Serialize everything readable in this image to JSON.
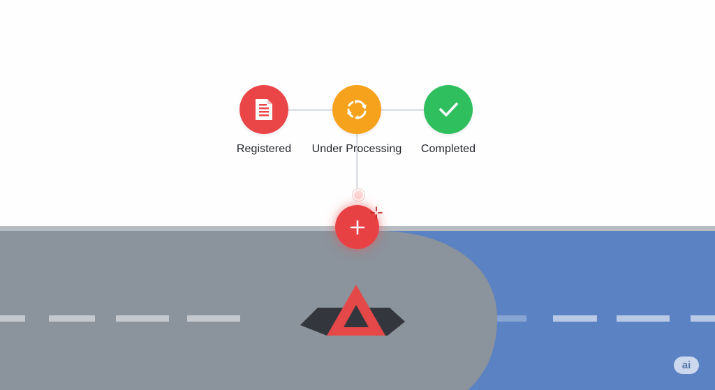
{
  "stepper": {
    "steps": [
      {
        "label": "Registered",
        "icon": "document-icon",
        "color": "#ea4647"
      },
      {
        "label": "Under Processing",
        "icon": "refresh-icon",
        "color": "#f7a21c"
      },
      {
        "label": "Completed",
        "icon": "checkmark-icon",
        "color": "#2fbf5f"
      }
    ]
  },
  "actions": {
    "add_icon": "plus-icon",
    "add_color": "#e84143"
  },
  "map": {
    "road_color": "#8b939c",
    "water_color": "#5b82c2",
    "marker_icon": "warning-triangle-icon",
    "marker_color": "#e54848"
  },
  "badge": {
    "label": "ai"
  }
}
